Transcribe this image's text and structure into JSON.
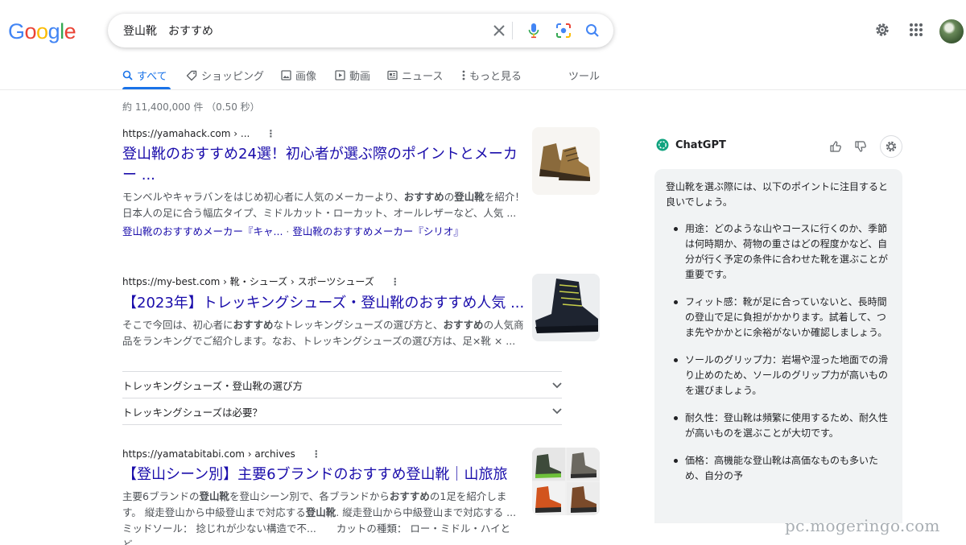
{
  "logo": {
    "letters": [
      "G",
      "o",
      "o",
      "g",
      "l",
      "e"
    ],
    "colors": [
      "#4285F4",
      "#EA4335",
      "#FBBC05",
      "#4285F4",
      "#34A853",
      "#EA4335"
    ]
  },
  "search": {
    "query": "登山靴　おすすめ"
  },
  "tabs": [
    {
      "label": "すべて",
      "icon": "search-icon"
    },
    {
      "label": "ショッピング",
      "icon": "tag-icon"
    },
    {
      "label": "画像",
      "icon": "image-icon"
    },
    {
      "label": "動画",
      "icon": "play-icon"
    },
    {
      "label": "ニュース",
      "icon": "news-icon"
    },
    {
      "label": "もっと見る",
      "icon": "more-vert-icon"
    }
  ],
  "tools_label": "ツール",
  "stats": "約 11,400,000 件 （0.50 秒）",
  "results": [
    {
      "cite": "https://yamahack.com › ...",
      "title": "登山靴のおすすめ24選！初心者が選ぶ際のポイントとメーカー ...",
      "snippet_html": "モンベルやキャラバンをはじめ初心者に人気のメーカーより、<b>おすすめ</b>の<b>登山靴</b>を紹介！日本人の足に合う幅広タイプ、ミドルカット・ローカット、オールレザーなど、人気 ...",
      "sitelink_1": "登山靴のおすすめメーカー『キャ...",
      "sitelink_sep": " · ",
      "sitelink_2": "登山靴のおすすめメーカー『シリオ』"
    },
    {
      "cite": "https://my-best.com › 靴・シューズ › スポーツシューズ",
      "title": "【2023年】トレッキングシューズ・登山靴のおすすめ人気 ...",
      "snippet_html": "そこで今回は、初心者に<b>おすすめ</b>なトレッキングシューズの選び方と、<b>おすすめ</b>の人気商品をランキングでご紹介します。なお、トレッキングシューズの選び方は、足×靴 × ..."
    },
    {
      "cite": "https://yamatabitabi.com › archives",
      "title": "【登山シーン別】主要6ブランドのおすすめ登山靴｜山旅旅",
      "snippet_html": "主要6ブランドの<b>登山靴</b>を登山シーン別で、各ブランドから<b>おすすめ</b>の1足を紹介します。 縦走登山から中級登山まで対応する<b>登山靴</b>. 縦走登山から中級登山まで対応する ...",
      "extra_line": "ミッドソール： 捻じれが少ない構造で不...　　カットの種類： ロー・ミドル・ハイとど..."
    }
  ],
  "questions": [
    "トレッキングシューズ・登山靴の選び方",
    "トレッキングシューズは必要？"
  ],
  "chatgpt": {
    "title": "ChatGPT",
    "intro": "登山靴を選ぶ際には、以下のポイントに注目すると良いでしょう。",
    "points": [
      "用途：どのような山やコースに行くのか、季節は何時期か、荷物の重さはどの程度かなど、自分が行く予定の条件に合わせた靴を選ぶことが重要です。",
      "フィット感：靴が足に合っていないと、長時間の登山で足に負担がかかります。試着して、つま先やかかとに余裕がないか確認しましょう。",
      "ソールのグリップ力：岩場や湿った地面での滑り止めのため、ソールのグリップ力が高いものを選びましょう。",
      "耐久性：登山靴は頻繁に使用するため、耐久性が高いものを選ぶことが大切です。",
      "価格：高機能な登山靴は高価なものも多いため、自分の予"
    ]
  },
  "watermark": "pc.mogeringo.com"
}
